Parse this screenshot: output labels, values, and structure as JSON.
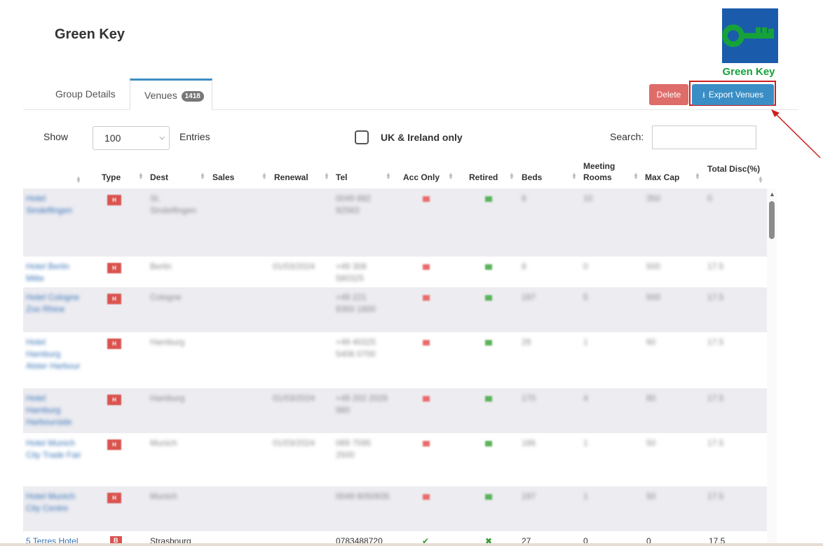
{
  "page": {
    "title": "Green Key"
  },
  "logo": {
    "text": "Green Key",
    "colors": {
      "box": "#1a5cab",
      "key": "#16a23a"
    }
  },
  "tabs": [
    {
      "label": "Group Details",
      "active": false
    },
    {
      "label": "Venues",
      "badge": "1418",
      "active": true
    }
  ],
  "actions": {
    "delete_label": "Delete",
    "export_label": "Export Venues"
  },
  "controls": {
    "show_label": "Show",
    "entries_value": "100",
    "entries_label": "Entries",
    "uk_label": "UK & Ireland only",
    "uk_checked": false,
    "search_label": "Search:",
    "search_value": ""
  },
  "table": {
    "headers": {
      "name": "",
      "type": "Type",
      "dest": "Dest",
      "sales": "Sales",
      "renewal": "Renewal",
      "tel": "Tel",
      "acc_only": "Acc Only",
      "retired": "Retired",
      "beds": "Beds",
      "meeting_rooms": "Meeting Rooms",
      "max_cap": "Max Cap",
      "total_disc": "Total Disc(%)"
    },
    "rows": [
      {
        "name": "Hotel Sindelfingen",
        "type": "H",
        "dest": "St. Sindelfingen",
        "renewal": "",
        "tel": "0049 882 92583",
        "beds": "8",
        "meeting": "10",
        "maxcap": "350",
        "disc": "0"
      },
      {
        "name": "Hotel Berlin Mitte",
        "type": "H",
        "dest": "Berlin",
        "renewal": "01/03/2024",
        "tel": "+49 308 580325",
        "beds": "8",
        "meeting": "0",
        "maxcap": "500",
        "disc": "17.5"
      },
      {
        "name": "Hotel Cologne Zoo Rhine",
        "type": "H",
        "dest": "Cologne",
        "renewal": "",
        "tel": "+49 221 9350 1800",
        "beds": "197",
        "meeting": "5",
        "maxcap": "500",
        "disc": "17.5"
      },
      {
        "name": "Hotel Hamburg Alster Harbour",
        "type": "H",
        "dest": "Hamburg",
        "renewal": "",
        "tel": "+49 40325 5406 0700",
        "beds": "29",
        "meeting": "1",
        "maxcap": "60",
        "disc": "17.5"
      },
      {
        "name": "Hotel Hamburg Harbourside",
        "type": "H",
        "dest": "Hamburg",
        "renewal": "01/03/2024",
        "tel": "+49 202 2028 980",
        "beds": "170",
        "meeting": "4",
        "maxcap": "80",
        "disc": "17.5"
      },
      {
        "name": "Hotel Munich City Trade Fair",
        "type": "H",
        "dest": "Munich",
        "renewal": "01/03/2024",
        "tel": "089 7595 2500",
        "beds": "186",
        "meeting": "1",
        "maxcap": "50",
        "disc": "17.5"
      },
      {
        "name": "Hotel Munich City Centre",
        "type": "H",
        "dest": "Munich",
        "renewal": "",
        "tel": "0049 8050935",
        "beds": "197",
        "meeting": "1",
        "maxcap": "50",
        "disc": "17.5"
      }
    ],
    "last_row": {
      "name": "5 Terres Hotel",
      "type": "B",
      "dest": "Strasbourg",
      "tel": "0783488720",
      "acc": "✔",
      "retired": "✖",
      "beds": "27",
      "meeting": "0",
      "maxcap": "0",
      "disc": "17.5"
    }
  }
}
